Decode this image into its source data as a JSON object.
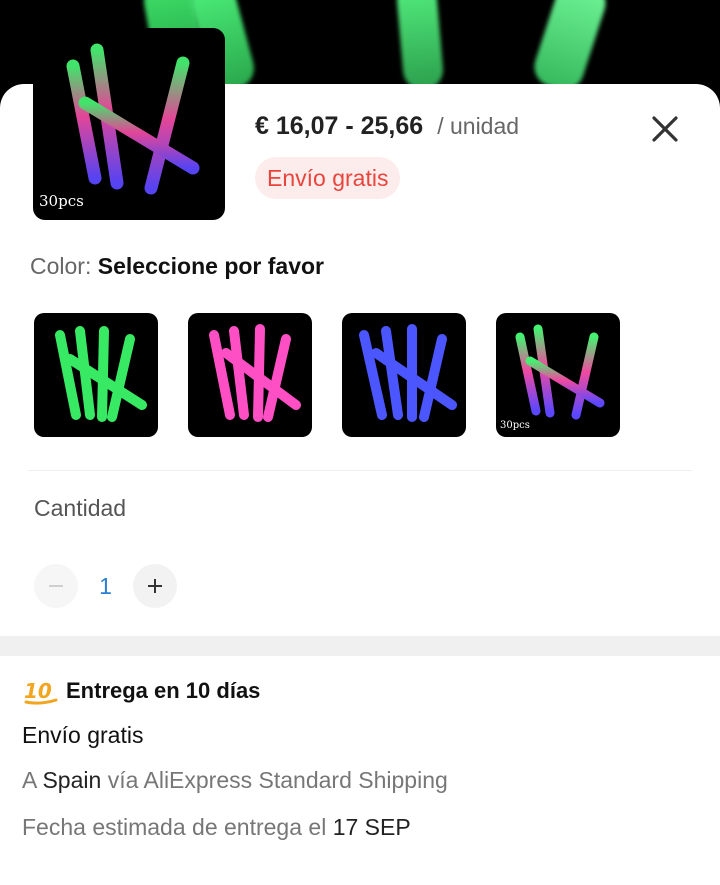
{
  "product": {
    "price_range": "€ 16,07 - 25,66",
    "unit_suffix": "/ unidad",
    "shipping_badge": "Envío gratis",
    "thumbnail_caption": "30pcs",
    "icons": {
      "close": "close-icon"
    }
  },
  "color_selector": {
    "label": "Color:",
    "value": "Seleccione por favor",
    "options": [
      {
        "id": "green",
        "colors": [
          "#3df36a",
          "#1fb348"
        ]
      },
      {
        "id": "pink",
        "colors": [
          "#ff58c8",
          "#d62591"
        ]
      },
      {
        "id": "blue",
        "colors": [
          "#5565ff",
          "#2a2cff"
        ]
      },
      {
        "id": "mixed",
        "caption": "30pcs"
      }
    ]
  },
  "quantity": {
    "label": "Cantidad",
    "value": "1",
    "decrement_symbol": "−",
    "increment_symbol": "+"
  },
  "delivery": {
    "title": "Entrega en 10 días",
    "icon": "hundred-points-icon",
    "shipping": "Envío gratis",
    "route_prefix": "A",
    "route_country": "Spain",
    "route_suffix": "vía AliExpress Standard Shipping",
    "date_prefix": "Fecha estimada de entrega el",
    "date_value": "17 SEP"
  },
  "colors": {
    "accent_red": "#e8453c",
    "badge_bg": "#fdecec",
    "quantity_blue": "#2d7fd1"
  }
}
